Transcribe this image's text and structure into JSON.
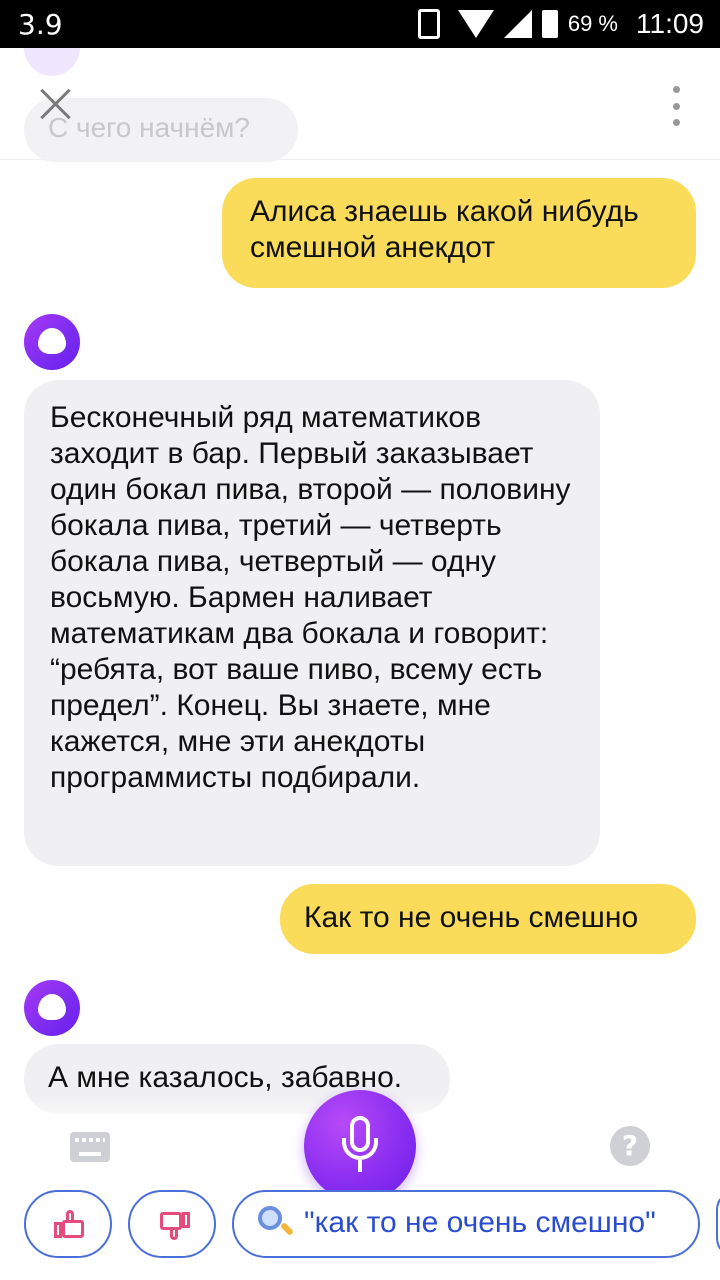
{
  "status_bar": {
    "left": "3.9",
    "battery": "69 %",
    "time": "11:09"
  },
  "header": {
    "ghost_suggestion": "С чего начнём?"
  },
  "messages": [
    {
      "from": "user",
      "text": "Алиса знаешь какой нибудь смешной анекдот"
    },
    {
      "from": "alice",
      "text": "Бесконечный ряд математиков заходит в бар. Первый заказывает один бокал пива, второй — половину бокала пива, третий — четверть бокала пива, четвертый — одну восьмую. Бармен наливает математикам два бокала и говорит: “ребята, вот ваше пиво, всему есть предел”. Конец. Вы знаете, мне кажется, мне эти анекдоты программисты подбирали."
    },
    {
      "from": "user",
      "text": "Как то не очень смешно"
    },
    {
      "from": "alice",
      "text": "А мне казалось, забавно."
    }
  ],
  "suggestions": {
    "search_chip": "\"как то не очень смешно\""
  },
  "help_glyph": "?",
  "colors": {
    "user_bubble": "#fadc5a",
    "bot_bubble": "#f0f0f2",
    "accent_purple": "#8a2ef1",
    "chip_border": "#4a6fd8",
    "chip_text": "#2a4dd0",
    "thumb_icon": "#e64c7b"
  },
  "icons": {
    "close": "close-icon",
    "menu": "more-vert-icon",
    "keyboard": "keyboard-icon",
    "mic": "microphone-icon",
    "help": "help-icon",
    "like": "thumbs-up-icon",
    "dislike": "thumbs-down-icon",
    "search": "search-icon",
    "alice": "alice-logo-icon"
  }
}
